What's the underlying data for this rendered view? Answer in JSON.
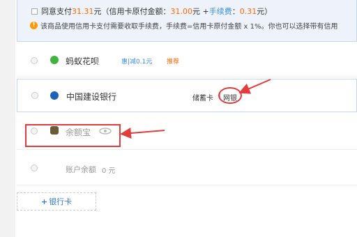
{
  "notice": {
    "agree_prefix": "同意支付",
    "agree_amount": "31.31",
    "agree_unit": "元",
    "paren_open": "（",
    "orig_label": "信用卡原付金额：",
    "orig_amount": "31.00",
    "orig_unit": "元 +",
    "fee_label": "手续费",
    "fee_colon": "：",
    "fee_amount": "0.31",
    "fee_unit": "元）",
    "info_text": "该商品使用信用卡支付需要收取手续费，手续费=信用卡原付金额 x 1%。你也可以选择带有信用"
  },
  "options": {
    "huabei": {
      "name": "蚂蚁花呗",
      "promo": "惠|减0.1元",
      "tag": "推荐"
    },
    "ccb": {
      "name": "中国建设银行",
      "card_type": "储蓄卡",
      "divider": "|",
      "netbank": "网银"
    },
    "yuebao": {
      "name": "余额宝"
    },
    "balance": {
      "name": "账户余额",
      "amount": "0 元"
    }
  },
  "add_card": {
    "plus": "+",
    "label": "银行卡"
  },
  "colors": {
    "accent_orange": "#ff6a00",
    "link_blue": "#3a8fe0",
    "annotation_red": "#e23c3c"
  }
}
